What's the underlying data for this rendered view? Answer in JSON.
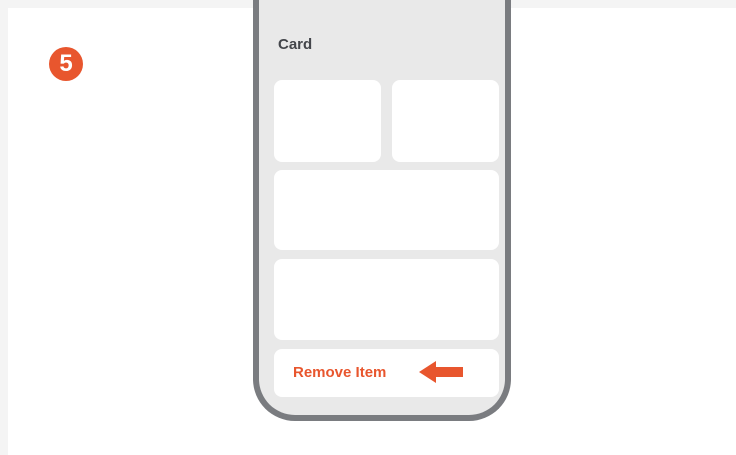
{
  "step": {
    "number": "5"
  },
  "card": {
    "title": "Card"
  },
  "remove_button": {
    "label": "Remove Item"
  },
  "icons": {
    "pointer": "left-arrow-icon"
  },
  "colors": {
    "accent": "#e8562e",
    "phone_border": "#7a7c80",
    "screen_background": "#e9e9e9",
    "tile": "#ffffff",
    "title_text": "#44464b"
  }
}
